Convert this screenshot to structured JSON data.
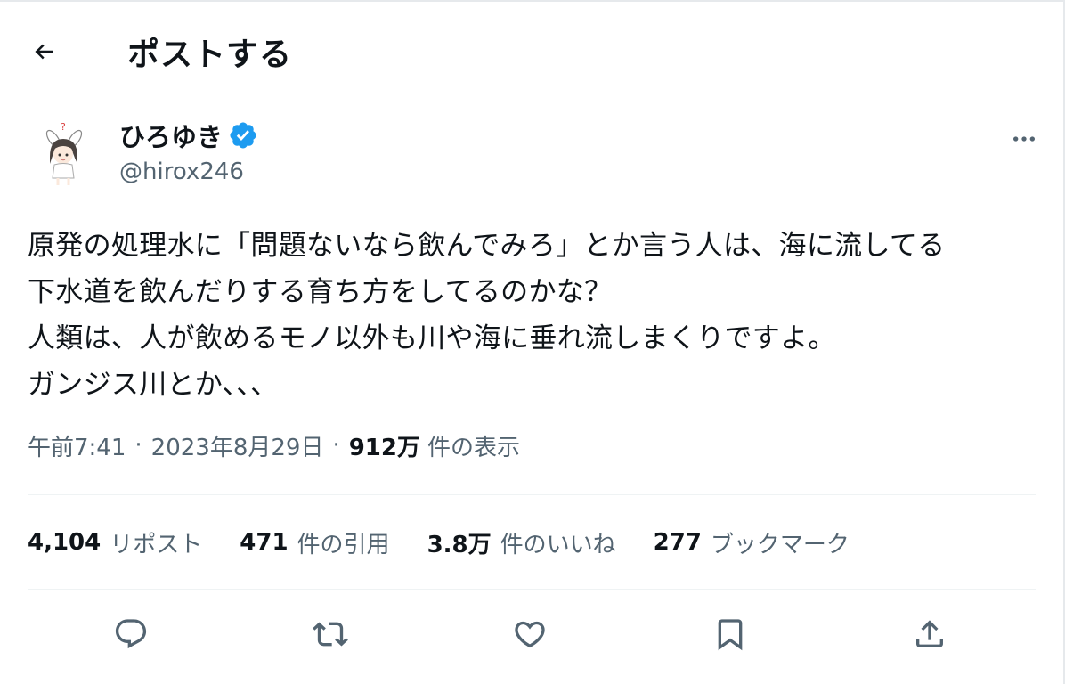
{
  "header": {
    "title": "ポストする"
  },
  "author": {
    "name": "ひろゆき",
    "handle": "@hirox246"
  },
  "post": {
    "lines": [
      "原発の処理水に「問題ないなら飲んでみろ」とか言う人は、海に流してる",
      "下水道を飲んだりする育ち方をしてるのかな？",
      "人類は、人が飲めるモノ以外も川や海に垂れ流しまくりですよ。",
      "ガンジス川とか、、、"
    ],
    "time": "午前7:41",
    "date": "2023年8月29日",
    "separator": "·",
    "views_count": "912万",
    "views_label": "件の表示"
  },
  "stats": {
    "reposts": {
      "count": "4,104",
      "label": "リポスト"
    },
    "quotes": {
      "count": "471",
      "label": "件の引用"
    },
    "likes": {
      "count": "3.8万",
      "label": "件のいいね"
    },
    "bookmarks": {
      "count": "277",
      "label": "ブックマーク"
    }
  },
  "icons": {
    "back": "arrow-left-icon",
    "verified": "verified-badge-icon",
    "more": "more-horizontal-icon",
    "reply": "reply-icon",
    "repost": "repost-icon",
    "like": "heart-icon",
    "bookmark": "bookmark-icon",
    "share": "share-icon"
  },
  "colors": {
    "text": "#0f1419",
    "secondary": "#536471",
    "verified": "#1d9bf0",
    "divider": "#eff3f4"
  }
}
